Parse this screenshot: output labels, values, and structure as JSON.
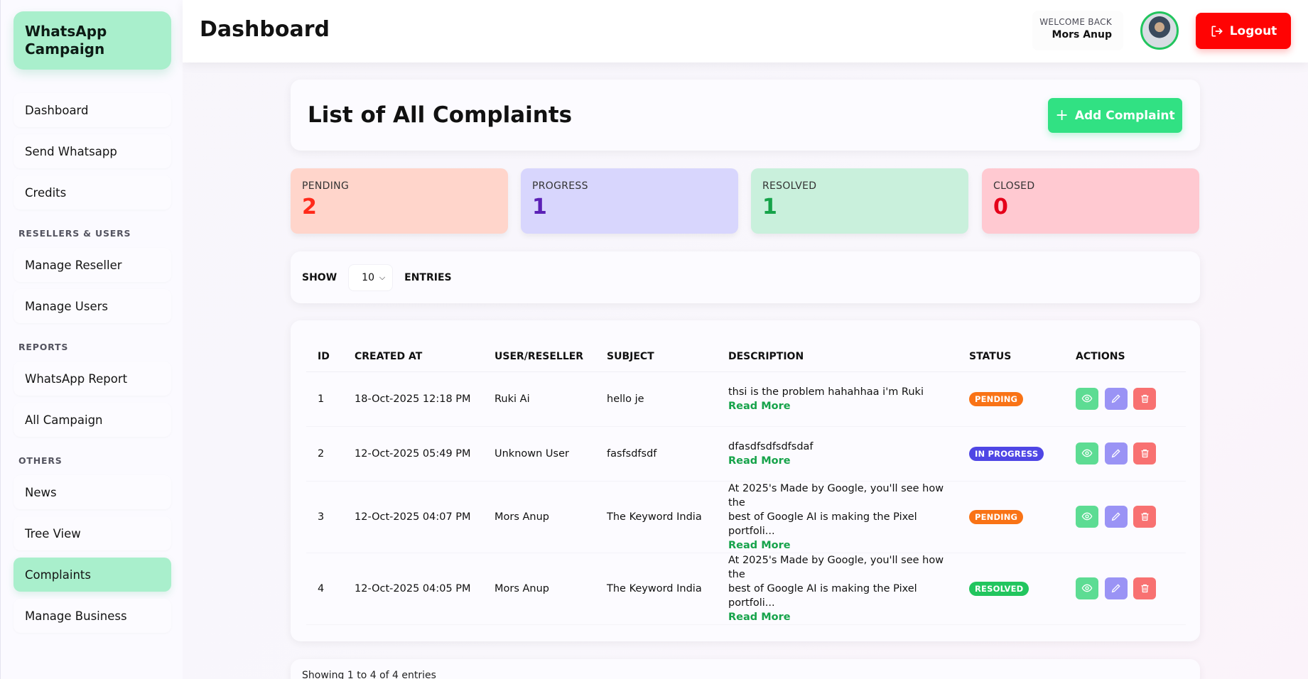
{
  "sidebar": {
    "brand": "WhatsApp Campaign",
    "items": [
      "Dashboard",
      "Send Whatsapp",
      "Credits"
    ],
    "sections": {
      "resellers": {
        "title": "RESELLERS & USERS",
        "items": [
          "Manage Reseller",
          "Manage Users"
        ]
      },
      "reports": {
        "title": "REPORTS",
        "items": [
          "WhatsApp Report",
          "All Campaign"
        ]
      },
      "others": {
        "title": "OTHERS",
        "items": [
          "News",
          "Tree View",
          "Complaints",
          "Manage Business"
        ]
      }
    },
    "active": "Complaints"
  },
  "header": {
    "title": "Dashboard",
    "welcome": "WELCOME BACK",
    "user": "Mors Anup",
    "logout": "Logout"
  },
  "main": {
    "title": "List of All Complaints",
    "add_button": "Add Complaint",
    "stats": [
      {
        "label": "PENDING",
        "value": "2",
        "color": "#ff2a1a",
        "bg": "#ffd5cb"
      },
      {
        "label": "PROGRESS",
        "value": "1",
        "color": "#5b21b6",
        "bg": "#d8d6fd"
      },
      {
        "label": "RESOLVED",
        "value": "1",
        "color": "#16a34a",
        "bg": "#c9f0dc"
      },
      {
        "label": "CLOSED",
        "value": "0",
        "color": "#e5001a",
        "bg": "#ffc9d1"
      }
    ],
    "show": {
      "label": "SHOW",
      "value": "10",
      "suffix": "ENTRIES"
    },
    "table": {
      "headers": [
        "ID",
        "CREATED AT",
        "USER/RESELLER",
        "SUBJECT",
        "DESCRIPTION",
        "STATUS",
        "ACTIONS"
      ],
      "read_more": "Read More",
      "rows": [
        {
          "id": "1",
          "created": "18-Oct-2025 12:18 PM",
          "user": "Ruki Ai",
          "subject": "hello je",
          "desc1": "thsi is the problem hahahhaa i'm Ruki",
          "desc2": "",
          "status": "PENDING"
        },
        {
          "id": "2",
          "created": "12-Oct-2025 05:49 PM",
          "user": "Unknown User",
          "subject": "fasfsdfsdf",
          "desc1": "dfasdfsdfsdfsdaf",
          "desc2": "",
          "status": "IN PROGRESS"
        },
        {
          "id": "3",
          "created": "12-Oct-2025 04:07 PM",
          "user": "Mors Anup",
          "subject": "The Keyword India",
          "desc1": "At 2025's Made by Google, you'll see how the",
          "desc2": "best of Google AI is making the Pixel portfoli...",
          "status": "PENDING"
        },
        {
          "id": "4",
          "created": "12-Oct-2025 04:05 PM",
          "user": "Mors Anup",
          "subject": "The Keyword India",
          "desc1": "At 2025's Made by Google, you'll see how the",
          "desc2": "best of Google AI is making the Pixel portfoli...",
          "status": "RESOLVED"
        }
      ]
    },
    "footer": "Showing 1 to 4 of 4 entries"
  }
}
